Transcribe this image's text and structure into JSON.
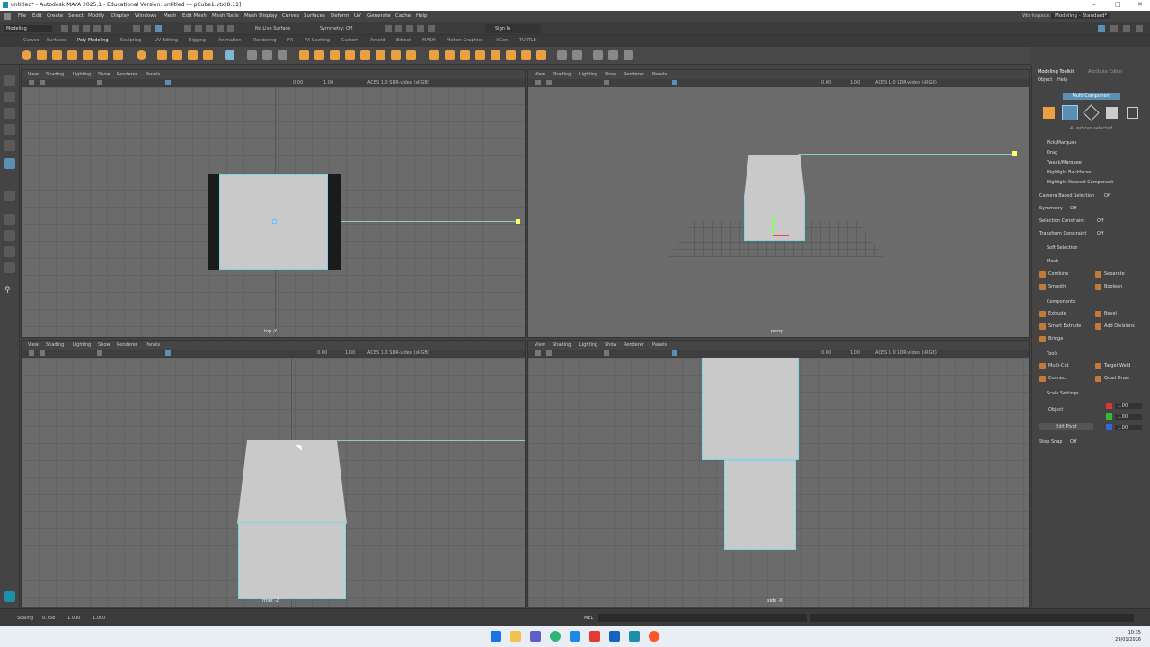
{
  "window": {
    "title": "untitled* - Autodesk MAYA 2025.1 - Educational Version: untitled --- pCube1.vtx[8:11]",
    "workspace_label": "Workspace:",
    "workspace_value": "Modeling - Standard*"
  },
  "menus": [
    "File",
    "Edit",
    "Create",
    "Select",
    "Modify",
    "Display",
    "Windows",
    "Mesh",
    "Edit Mesh",
    "Mesh Tools",
    "Mesh Display",
    "Curves",
    "Surfaces",
    "Deform",
    "UV",
    "Generate",
    "Cache",
    "Help"
  ],
  "status": {
    "mode": "Modeling",
    "live_surface": "No Live Surface",
    "symmetry": "Symmetry: Off",
    "sign_in": "Sign In"
  },
  "shelf_tabs": [
    "Curves",
    "Surfaces",
    "Poly Modeling",
    "Sculpting",
    "UV Editing",
    "Rigging",
    "Animation",
    "Rendering",
    "FX",
    "FX Caching",
    "Custom",
    "Arnold",
    "Bifrost",
    "MASH",
    "Motion Graphics",
    "XGen",
    "TURTLE"
  ],
  "shelf_active": "Poly Modeling",
  "viewport_menu": [
    "View",
    "Shading",
    "Lighting",
    "Show",
    "Renderer",
    "Panels"
  ],
  "viewport_toolbar": {
    "val1": "0.00",
    "val2": "1.00",
    "color": "ACES 1.0 SDR-video (sRGB)"
  },
  "viewports": {
    "top": {
      "label": "top -Y"
    },
    "persp": {
      "label": "persp"
    },
    "front": {
      "label": "front -Z"
    },
    "side": {
      "label": "side -X"
    }
  },
  "right_panel": {
    "tab1": "Modeling Toolkit",
    "tab2": "Attribute Editor",
    "sub1": "Object",
    "sub2": "Help",
    "multi": "Multi-Component",
    "selected": "4 vertices selected",
    "options": [
      "Pick/Marquee",
      "Drag",
      "Tweak/Marquee",
      "Highlight Backfaces",
      "Highlight Nearest Component"
    ],
    "camera_based": "Camera Based Selection",
    "camera_based_val": "Off",
    "symmetry": "Symmetry",
    "symmetry_val": "Off",
    "sel_constraint": "Selection Constraint",
    "sel_constraint_val": "Off",
    "transform_constraint": "Transform Constraint",
    "transform_constraint_val": "Off",
    "soft_selection": "Soft Selection",
    "mesh_header": "Mesh",
    "mesh_btns": [
      "Combine",
      "Separate",
      "Smooth",
      "Boolean"
    ],
    "components_header": "Components",
    "comp_btns": [
      "Extrude",
      "Bevel",
      "Smart Extrude",
      "Add Divisions",
      "Bridge"
    ],
    "tools_header": "Tools",
    "tool_btns": [
      "Multi-Cut",
      "Target Weld",
      "Connect",
      "Quad Draw"
    ],
    "scale_header": "Scale Settings",
    "scale_object": "Object",
    "scale_vals": [
      "1.00",
      "1.00",
      "1.00"
    ],
    "edit_pivot": "Edit Pivot",
    "step_snap": "Step Snap",
    "step_snap_val": "Off"
  },
  "command": {
    "label": "Scaling",
    "vals": [
      "0.758",
      "1.000",
      "1.000"
    ],
    "mel": "MEL"
  },
  "taskbar": {
    "time": "10:35",
    "date": "29/01/2026"
  },
  "colors": {
    "accent": "#7fd6e6",
    "orange": "#e8a040",
    "viewport": "#6b6b6b"
  }
}
